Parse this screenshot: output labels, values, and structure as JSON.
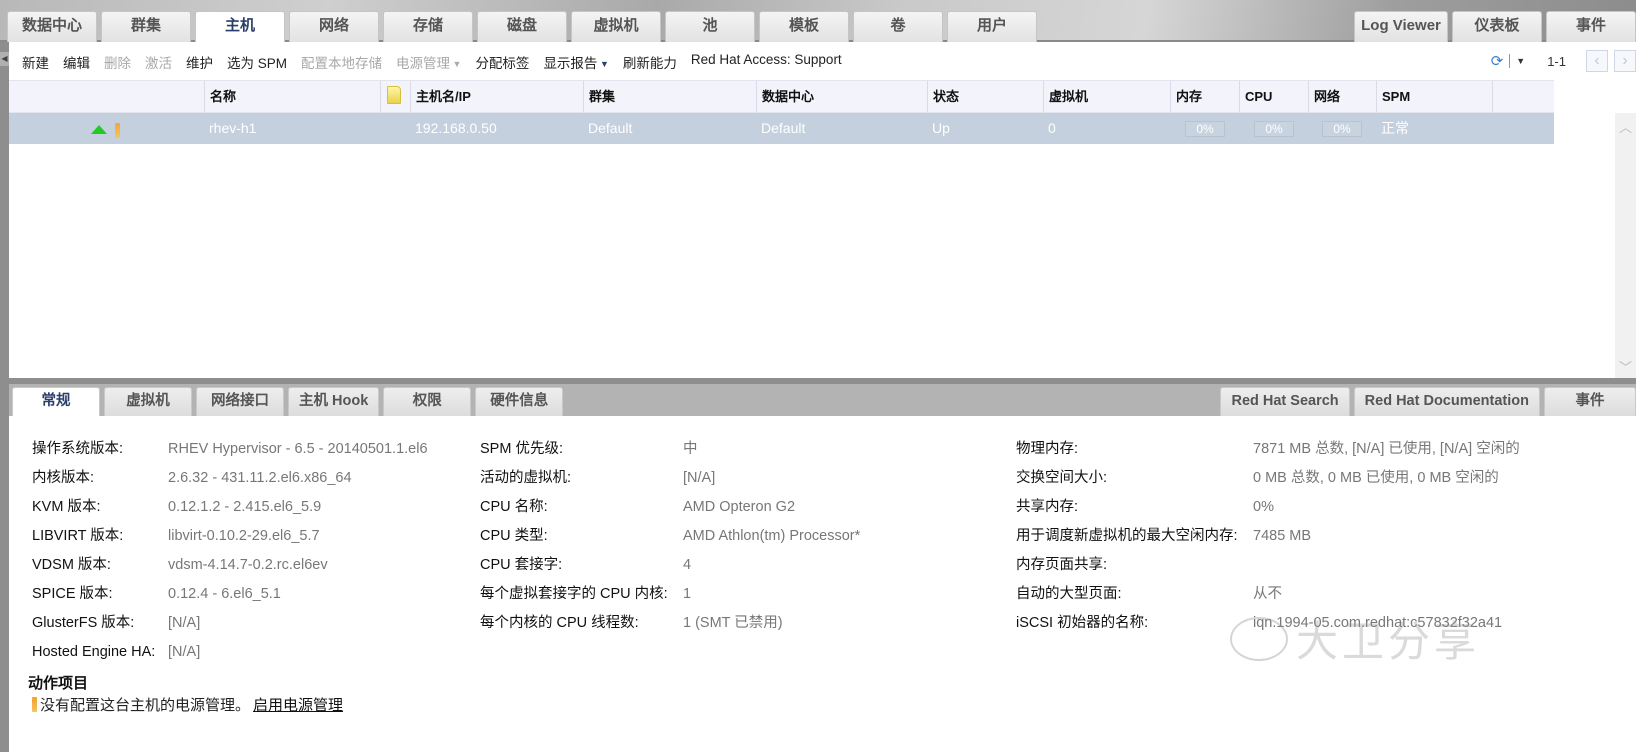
{
  "main_tabs": {
    "left": [
      {
        "label": "数据中心",
        "active": false
      },
      {
        "label": "群集",
        "active": false
      },
      {
        "label": "主机",
        "active": true
      },
      {
        "label": "网络",
        "active": false
      },
      {
        "label": "存储",
        "active": false
      },
      {
        "label": "磁盘",
        "active": false
      },
      {
        "label": "虚拟机",
        "active": false
      },
      {
        "label": "池",
        "active": false
      },
      {
        "label": "模板",
        "active": false
      },
      {
        "label": "卷",
        "active": false
      },
      {
        "label": "用户",
        "active": false
      }
    ],
    "right": [
      {
        "label": "Log Viewer"
      },
      {
        "label": "仪表板"
      },
      {
        "label": "事件"
      }
    ]
  },
  "toolbar": {
    "actions": [
      {
        "label": "新建",
        "enabled": true
      },
      {
        "label": "编辑",
        "enabled": true
      },
      {
        "label": "删除",
        "enabled": false
      },
      {
        "label": "激活",
        "enabled": false
      },
      {
        "label": "维护",
        "enabled": true
      },
      {
        "label": "选为 SPM",
        "enabled": true
      },
      {
        "label": "配置本地存储",
        "enabled": false
      },
      {
        "label": "电源管理",
        "enabled": false,
        "dropdown": true
      },
      {
        "label": "分配标签",
        "enabled": true
      },
      {
        "label": "显示报告",
        "enabled": true,
        "dropdown": true
      },
      {
        "label": "刷新能力",
        "enabled": true
      },
      {
        "label": "Red Hat Access: Support",
        "enabled": true
      }
    ],
    "pager": {
      "range": "1-1",
      "prev_icon": "chevron-left",
      "next_icon": "chevron-right"
    },
    "refresh_icon": "refresh"
  },
  "grid": {
    "columns": [
      "名称",
      "主机名/IP",
      "群集",
      "数据中心",
      "状态",
      "虚拟机",
      "内存",
      "CPU",
      "网络",
      "SPM"
    ],
    "rows": [
      {
        "status_icon": "up-arrow",
        "alert_icon": "exclamation",
        "name": "rhev-h1",
        "host_ip": "192.168.0.50",
        "cluster": "Default",
        "datacenter": "Default",
        "status": "Up",
        "vms": "0",
        "memory": "0%",
        "cpu": "0%",
        "network": "0%",
        "spm": "正常",
        "selected": true
      }
    ]
  },
  "sub_tabs": {
    "left": [
      {
        "label": "常规",
        "active": true
      },
      {
        "label": "虚拟机",
        "active": false
      },
      {
        "label": "网络接口",
        "active": false
      },
      {
        "label": "主机 Hook",
        "active": false
      },
      {
        "label": "权限",
        "active": false
      },
      {
        "label": "硬件信息",
        "active": false
      }
    ],
    "right": [
      {
        "label": "Red Hat Search"
      },
      {
        "label": "Red Hat Documentation"
      },
      {
        "label": "事件"
      }
    ]
  },
  "general": {
    "col1": [
      {
        "k": "操作系统版本:",
        "v": "RHEV Hypervisor - 6.5 - 20140501.1.el6"
      },
      {
        "k": "内核版本:",
        "v": "2.6.32 - 431.11.2.el6.x86_64"
      },
      {
        "k": "KVM 版本:",
        "v": "0.12.1.2 - 2.415.el6_5.9"
      },
      {
        "k": "LIBVIRT 版本:",
        "v": "libvirt-0.10.2-29.el6_5.7"
      },
      {
        "k": "VDSM 版本:",
        "v": "vdsm-4.14.7-0.2.rc.el6ev"
      },
      {
        "k": "SPICE 版本:",
        "v": "0.12.4 - 6.el6_5.1"
      },
      {
        "k": "GlusterFS 版本:",
        "v": "[N/A]"
      },
      {
        "k": "Hosted Engine HA:",
        "v": "[N/A]"
      }
    ],
    "col2": [
      {
        "k": "SPM 优先级:",
        "v": "中"
      },
      {
        "k": "活动的虚拟机:",
        "v": "[N/A]"
      },
      {
        "k": "CPU 名称:",
        "v": "AMD Opteron G2"
      },
      {
        "k": "CPU 类型:",
        "v": "AMD Athlon(tm) Processor*"
      },
      {
        "k": "CPU 套接字:",
        "v": "4"
      },
      {
        "k": "每个虚拟套接字的 CPU 内核:",
        "v": "1"
      },
      {
        "k": "每个内核的 CPU 线程数:",
        "v": "1 (SMT 已禁用)"
      }
    ],
    "col3": [
      {
        "k": "物理内存:",
        "v": "7871 MB 总数, [N/A] 已使用, [N/A] 空闲的"
      },
      {
        "k": "交换空间大小:",
        "v": "0 MB 总数, 0 MB 已使用, 0 MB 空闲的"
      },
      {
        "k": "共享内存:",
        "v": "0%"
      },
      {
        "k": "用于调度新虚拟机的最大空闲内存:",
        "v": "7485 MB"
      },
      {
        "k": "内存页面共享:",
        "v": ""
      },
      {
        "k": "自动的大型页面:",
        "v": "从不"
      },
      {
        "k": "iSCSI 初始器的名称:",
        "v": "iqn.1994-05.com.redhat:c57832f32a41"
      }
    ],
    "action_items": {
      "title": "动作项目",
      "message": "没有配置这台主机的电源管理。",
      "link": "启用电源管理"
    }
  },
  "watermark": "大卫分享"
}
